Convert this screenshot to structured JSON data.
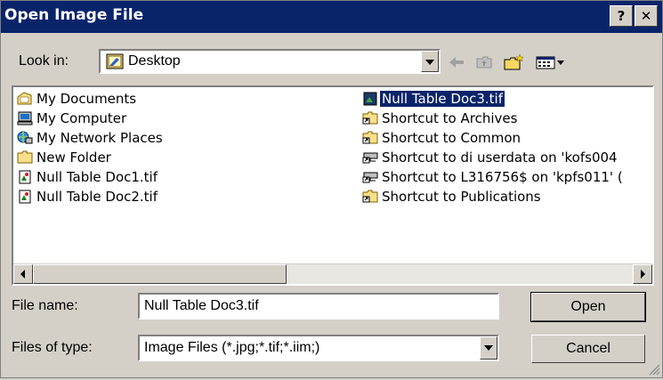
{
  "window": {
    "title": "Open Image File",
    "help_label": "?",
    "close_label": "✕"
  },
  "lookin": {
    "label": "Look in:",
    "value": "Desktop"
  },
  "files": {
    "left": [
      {
        "label": "My Documents",
        "icon": "my-documents-icon"
      },
      {
        "label": "My Computer",
        "icon": "computer-icon"
      },
      {
        "label": "My Network Places",
        "icon": "network-icon"
      },
      {
        "label": "New Folder",
        "icon": "folder-icon"
      },
      {
        "label": "Null Table Doc1.tif",
        "icon": "image-file-icon"
      },
      {
        "label": "Null Table Doc2.tif",
        "icon": "image-file-icon"
      }
    ],
    "right": [
      {
        "label": "Null Table Doc3.tif",
        "icon": "image-file-icon",
        "selected": true
      },
      {
        "label": "Shortcut to Archives",
        "icon": "folder-shortcut-icon"
      },
      {
        "label": "Shortcut to Common",
        "icon": "folder-shortcut-icon"
      },
      {
        "label": "Shortcut to di userdata on 'kofs004",
        "icon": "network-drive-shortcut-icon"
      },
      {
        "label": "Shortcut to L316756$ on 'kpfs011' (",
        "icon": "network-drive-shortcut-icon"
      },
      {
        "label": "Shortcut to Publications",
        "icon": "folder-shortcut-icon"
      }
    ]
  },
  "filename": {
    "label": "File name:",
    "value": "Null Table Doc3.tif"
  },
  "filetype": {
    "label": "Files of type:",
    "value": "Image Files (*.jpg;*.tif;*.iim;)"
  },
  "buttons": {
    "open": "Open",
    "cancel": "Cancel"
  },
  "colors": {
    "titlebar": "#0a246a",
    "face": "#d4d0c8",
    "selection": "#0a246a"
  }
}
